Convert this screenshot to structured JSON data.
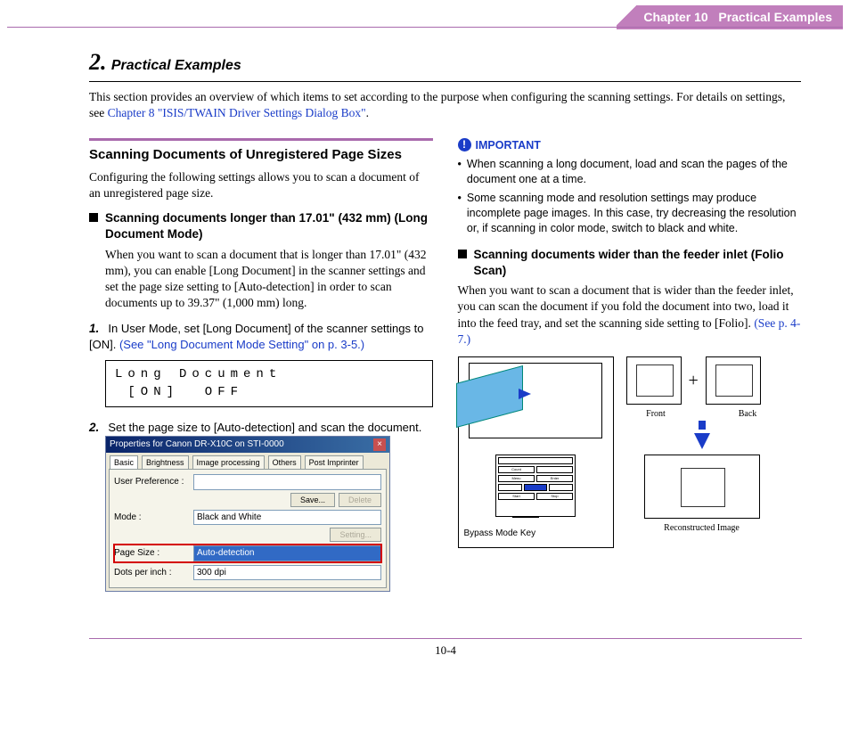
{
  "header": {
    "chapter": "Chapter 10",
    "title": "Practical Examples"
  },
  "section": {
    "number": "2.",
    "title": "Practical Examples"
  },
  "intro": {
    "text": "This section provides an overview of which items to set according to the purpose when configuring the scanning settings. For details on settings, see ",
    "link": "Chapter 8 \"ISIS/TWAIN Driver Settings Dialog Box\"",
    "after": "."
  },
  "left": {
    "subsection_title": "Scanning Documents of Unregistered Page Sizes",
    "subsection_body": "Configuring the following settings allows you to scan a document of an unregistered page size.",
    "square1_title": "Scanning documents longer than 17.01\" (432 mm) (Long Document Mode)",
    "square1_body": "When you want to scan a document that is longer than 17.01\" (432 mm), you can enable [Long Document] in the scanner settings and set the page size setting to [Auto-detection] in order to scan documents up to 39.37\" (1,000 mm) long.",
    "step1_num": "1.",
    "step1_text": "In User Mode, set [Long Document] of the scanner settings to [ON]. ",
    "step1_link": "(See \"Long Document Mode Setting\" on p. 3-5.)",
    "lcd_line1": "Long Document",
    "lcd_line2": " [ON]  OFF",
    "step2_num": "2.",
    "step2_text": "Set the page size to [Auto-detection] and scan the document.",
    "dialog": {
      "title": "Properties for Canon DR-X10C on STI-0000",
      "tabs": [
        "Basic",
        "Brightness",
        "Image processing",
        "Others",
        "Post Imprinter"
      ],
      "rows": {
        "user_pref_label": "User Preference :",
        "save_btn": "Save...",
        "delete_btn": "Delete",
        "mode_label": "Mode :",
        "mode_value": "Black and White",
        "setting_btn": "Setting...",
        "page_size_label": "Page Size :",
        "page_size_value": "Auto-detection",
        "dots_label": "Dots per inch :",
        "dots_value": "300 dpi"
      }
    }
  },
  "right": {
    "important_label": "IMPORTANT",
    "bullet1": "When scanning a long document, load and scan the pages of the document one at a time.",
    "bullet2": "Some scanning mode and resolution settings may produce incomplete page images. In this case, try decreasing the resolution or, if scanning in color mode, switch to black and white.",
    "square2_title": "Scanning documents wider than the feeder inlet (Folio Scan)",
    "square2_body_pre": "When you want to scan a document that is wider than the feeder inlet, you can scan the document if you fold the document into two, load it into the feed tray, and set the scanning side setting to [Folio]. ",
    "square2_link": "(See p. 4-7.)",
    "fig": {
      "bypass_label": "Bypass Mode Key",
      "front_label": "Front",
      "back_label": "Back",
      "recon_label": "Reconstructed Image"
    }
  },
  "footer": {
    "page": "10-4"
  }
}
